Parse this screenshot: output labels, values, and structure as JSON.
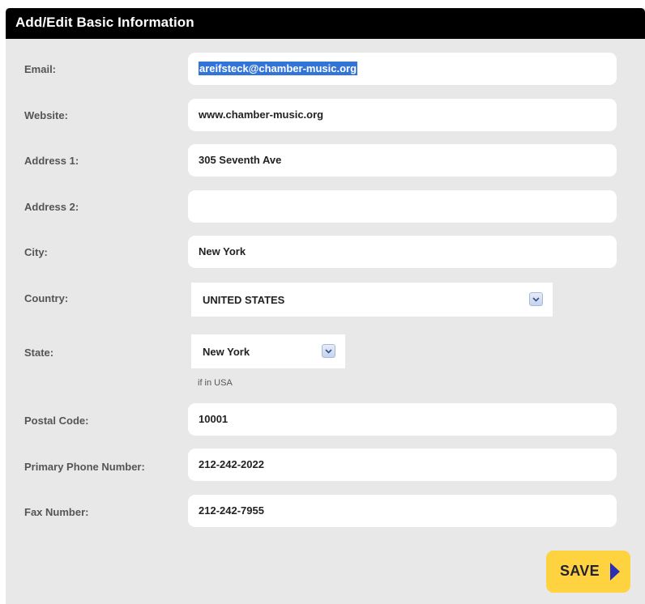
{
  "header": {
    "title": "Add/Edit Basic Information"
  },
  "form": {
    "email": {
      "label": "Email:",
      "value": "areifsteck@chamber-music.org"
    },
    "website": {
      "label": "Website:",
      "value": "www.chamber-music.org"
    },
    "address1": {
      "label": "Address 1:",
      "value": "305 Seventh Ave"
    },
    "address2": {
      "label": "Address 2:",
      "value": ""
    },
    "city": {
      "label": "City:",
      "value": "New York"
    },
    "country": {
      "label": "Country:",
      "value": "UNITED STATES"
    },
    "state": {
      "label": "State:",
      "value": "New York",
      "hint": "if in USA"
    },
    "postal": {
      "label": "Postal Code:",
      "value": "10001"
    },
    "phone": {
      "label": "Primary Phone Number:",
      "value": "212-242-2022"
    },
    "fax": {
      "label": "Fax Number:",
      "value": "212-242-7955"
    }
  },
  "actions": {
    "save_label": "SAVE"
  },
  "colors": {
    "header_bg": "#000000",
    "panel_bg": "#e8e8e8",
    "save_bg": "#ffd23f",
    "save_arrow": "#2b2fb8",
    "selection": "#3375d6"
  },
  "icons": {
    "dropdown": "chevron-down-icon",
    "save_arrow": "play-arrow-icon"
  }
}
